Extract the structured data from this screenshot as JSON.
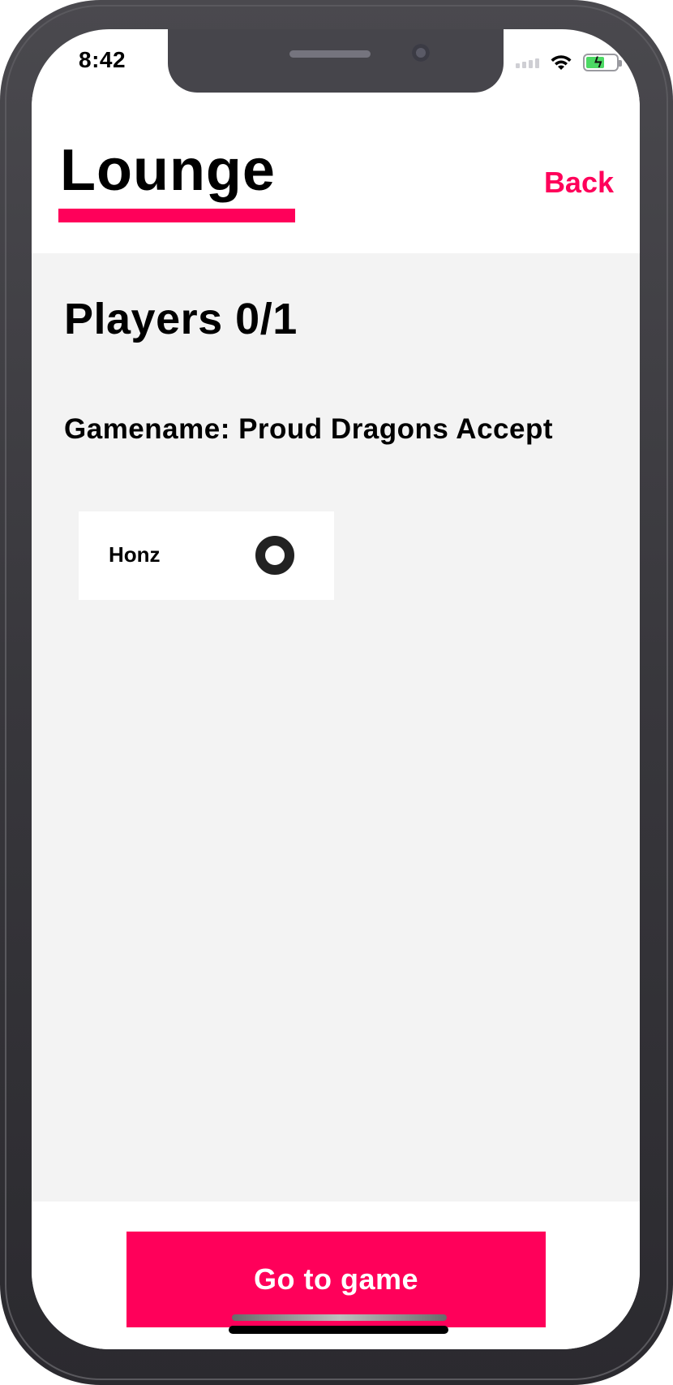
{
  "status_bar": {
    "time": "8:42",
    "battery_color": "#4cd964"
  },
  "header": {
    "title": "Lounge",
    "back_label": "Back",
    "accent_color": "#ff005a"
  },
  "lounge": {
    "players_heading": "Players 0/1",
    "gamename_text": "Gamename: Proud Dragons Accept",
    "players": [
      {
        "name": "Honz",
        "status_icon": "ring-icon",
        "ready": false
      }
    ]
  },
  "footer": {
    "go_button_label": "Go to game"
  }
}
